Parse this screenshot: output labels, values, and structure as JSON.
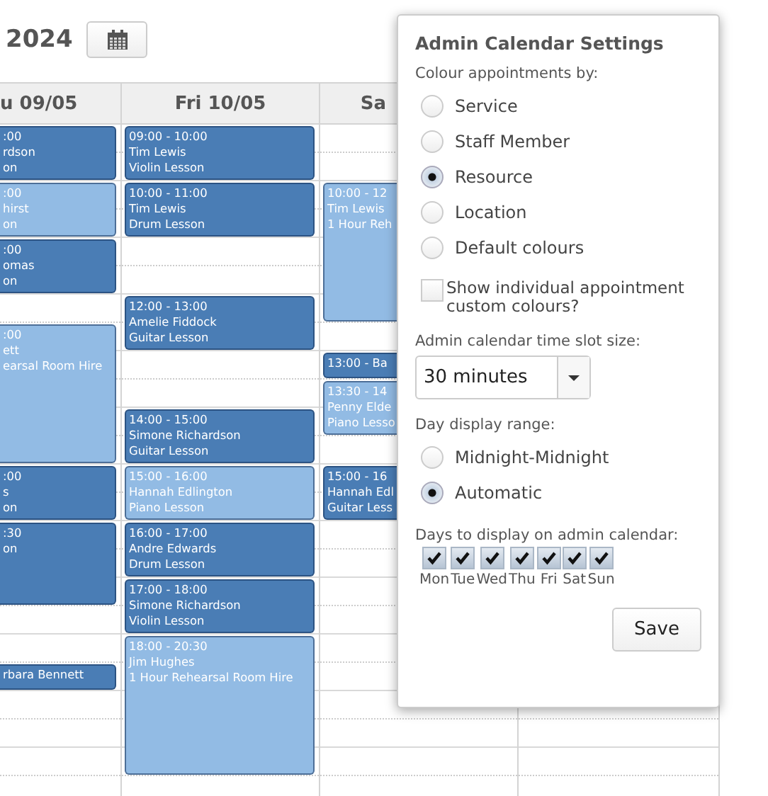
{
  "header": {
    "year": "2024"
  },
  "columns": [
    {
      "heading": "u 09/05",
      "appointments": [
        {
          "color": "#4a7db5",
          "lines": [
            ":00",
            "rdson",
            "on"
          ]
        },
        {
          "color": "#92bbe4",
          "lines": [
            ":00",
            "hirst",
            "on"
          ]
        },
        {
          "color": "#4a7db5",
          "lines": [
            ":00",
            "omas",
            "on"
          ]
        },
        {
          "color": "#92bbe4",
          "lines": [
            ":00",
            "ett",
            "earsal Room Hire"
          ]
        },
        {
          "color": "#4a7db5",
          "lines": [
            ":00",
            "s",
            "on"
          ]
        },
        {
          "color": "#4a7db5",
          "lines": [
            ":30",
            "on"
          ]
        },
        {
          "color": "#4a7db5",
          "lines": [
            "rbara Bennett"
          ]
        }
      ]
    },
    {
      "heading": "Fri 10/05",
      "appointments": [
        {
          "color": "#4a7db5",
          "lines": [
            "09:00 - 10:00",
            "Tim Lewis",
            "Violin Lesson"
          ]
        },
        {
          "color": "#4a7db5",
          "lines": [
            "10:00 - 11:00",
            "Tim Lewis",
            "Drum Lesson"
          ]
        },
        {
          "color": "#4a7db5",
          "lines": [
            "12:00 - 13:00",
            "Amelie Fiddock",
            "Guitar Lesson"
          ]
        },
        {
          "color": "#4a7db5",
          "lines": [
            "14:00 - 15:00",
            "Simone Richardson",
            "Guitar Lesson"
          ]
        },
        {
          "color": "#92bbe4",
          "lines": [
            "15:00 - 16:00",
            "Hannah Edlington",
            "Piano Lesson"
          ]
        },
        {
          "color": "#4a7db5",
          "lines": [
            "16:00 - 17:00",
            "Andre Edwards",
            "Drum Lesson"
          ]
        },
        {
          "color": "#4a7db5",
          "lines": [
            "17:00 - 18:00",
            "Simone Richardson",
            "Violin Lesson"
          ]
        },
        {
          "color": "#92bbe4",
          "lines": [
            "18:00 - 20:30",
            "Jim Hughes",
            "1 Hour Rehearsal Room Hire"
          ]
        }
      ]
    },
    {
      "heading": "Sa",
      "appointments": [
        {
          "color": "#92bbe4",
          "lines": [
            "10:00 - 12",
            "Tim Lewis",
            "1 Hour Reh"
          ]
        },
        {
          "color": "#4a7db5",
          "lines": [
            "13:00 - Ba"
          ]
        },
        {
          "color": "#92bbe4",
          "lines": [
            "13:30 - 14",
            "Penny Elde",
            "Piano Lesso"
          ]
        },
        {
          "color": "#4a7db5",
          "lines": [
            "15:00 - 16",
            "Hannah Edl",
            "Guitar Less"
          ]
        }
      ]
    }
  ],
  "settings": {
    "title": "Admin Calendar Settings",
    "colour_label": "Colour appointments by:",
    "colour_options": [
      {
        "label": "Service",
        "selected": false
      },
      {
        "label": "Staff Member",
        "selected": false
      },
      {
        "label": "Resource",
        "selected": true
      },
      {
        "label": "Location",
        "selected": false
      },
      {
        "label": "Default colours",
        "selected": false
      }
    ],
    "custom_colours": {
      "label": "Show individual appointment custom colours?",
      "checked": false
    },
    "slot_label": "Admin calendar time slot size:",
    "slot_size": {
      "value": "30 minutes"
    },
    "range_label": "Day display range:",
    "range_options": [
      {
        "label": "Midnight-Midnight",
        "selected": false
      },
      {
        "label": "Automatic",
        "selected": true
      }
    ],
    "days_label": "Days to display on admin calendar:",
    "days": [
      {
        "label": "Mon",
        "checked": true
      },
      {
        "label": "Tue",
        "checked": true
      },
      {
        "label": "Wed",
        "checked": true
      },
      {
        "label": "Thu",
        "checked": true
      },
      {
        "label": "Fri",
        "checked": true
      },
      {
        "label": "Sat",
        "checked": true
      },
      {
        "label": "Sun",
        "checked": true
      }
    ],
    "save": "Save"
  }
}
